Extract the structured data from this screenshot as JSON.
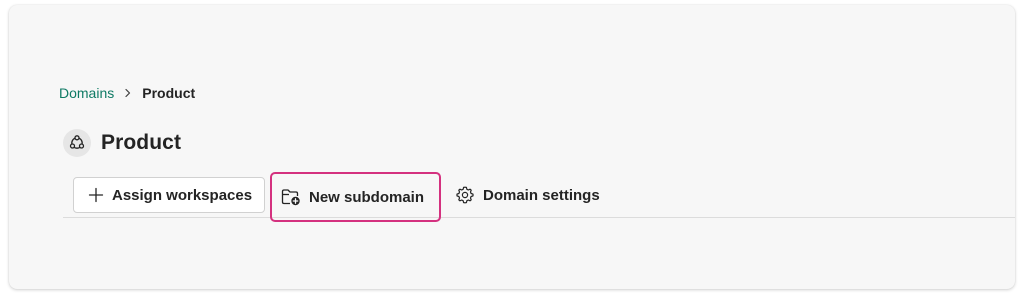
{
  "breadcrumb": {
    "parent": "Domains",
    "separator_icon": "chevron-right-icon",
    "current": "Product"
  },
  "header": {
    "icon": "domain-icon",
    "title": "Product"
  },
  "toolbar": {
    "assign_label": "Assign workspaces",
    "assign_icon": "add-icon",
    "new_subdomain_label": "New subdomain",
    "new_subdomain_icon": "folder-add-icon",
    "settings_label": "Domain settings",
    "settings_icon": "gear-icon"
  },
  "colors": {
    "link": "#0f7a64",
    "highlight_border": "#d4317f",
    "card_bg": "#f7f7f7"
  }
}
